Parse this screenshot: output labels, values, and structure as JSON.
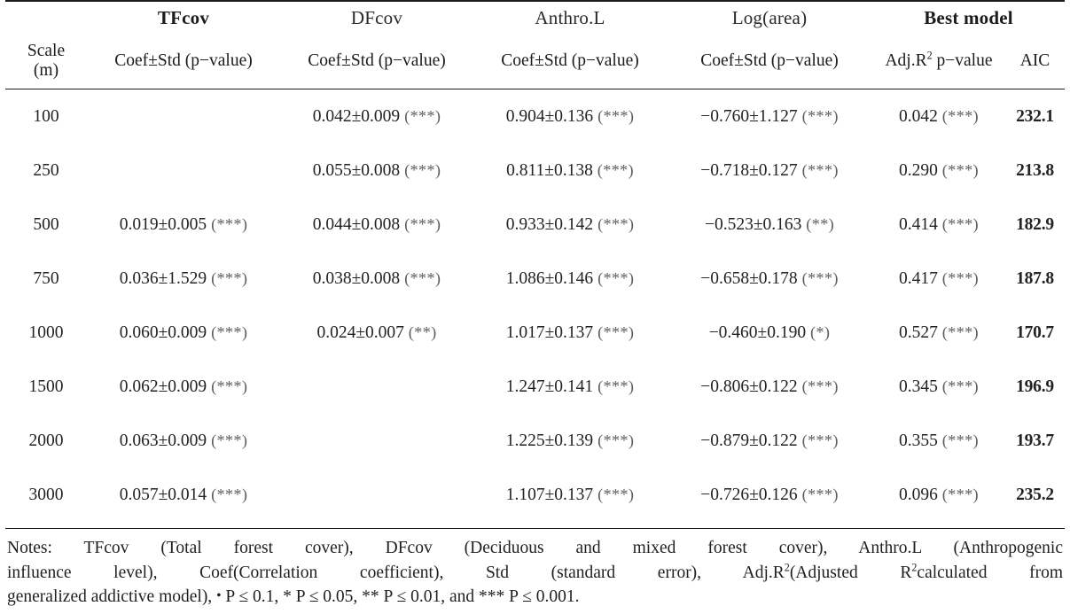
{
  "table": {
    "group_headers": [
      {
        "label": "",
        "style": "blank"
      },
      {
        "label": "TFcov",
        "style": "bold"
      },
      {
        "label": "DFcov",
        "style": "plain"
      },
      {
        "label": "Anthro.L",
        "style": "plain"
      },
      {
        "label": "Log(area)",
        "style": "plain"
      },
      {
        "label": "Best model",
        "style": "bold"
      }
    ],
    "sub_headers": {
      "scale_line1": "Scale",
      "scale_line2": "(m)",
      "tfcov": "Coef±Std (p−value)",
      "dfcov": "Coef±Std (p−value)",
      "anthro": "Coef±Std (p−value)",
      "logarea": "Coef±Std (p−value)",
      "adjr2_prefix": "Adj.R",
      "adjr2_sup": "2",
      "adjr2_suffix": " p−value",
      "aic": "AIC"
    },
    "rows": [
      {
        "scale": "100",
        "tfcov": "",
        "tfcov_sig": "",
        "dfcov": "0.042±0.009",
        "dfcov_sig": "(***)",
        "anthro": "0.904±0.136",
        "anthro_sig": "(***)",
        "logarea": "−0.760±1.127",
        "logarea_sig": "(***)",
        "adjr2": "0.042",
        "adjr2_sig": "(***)",
        "aic": "232.1"
      },
      {
        "scale": "250",
        "tfcov": "",
        "tfcov_sig": "",
        "dfcov": "0.055±0.008",
        "dfcov_sig": "(***)",
        "anthro": "0.811±0.138",
        "anthro_sig": "(***)",
        "logarea": "−0.718±0.127",
        "logarea_sig": "(***)",
        "adjr2": "0.290",
        "adjr2_sig": "(***)",
        "aic": "213.8"
      },
      {
        "scale": "500",
        "tfcov": "0.019±0.005",
        "tfcov_sig": "(***)",
        "dfcov": "0.044±0.008",
        "dfcov_sig": "(***)",
        "anthro": "0.933±0.142",
        "anthro_sig": "(***)",
        "logarea": "−0.523±0.163",
        "logarea_sig": "(**)",
        "adjr2": "0.414",
        "adjr2_sig": "(***)",
        "aic": "182.9"
      },
      {
        "scale": "750",
        "tfcov": "0.036±1.529",
        "tfcov_sig": "(***)",
        "dfcov": "0.038±0.008",
        "dfcov_sig": "(***)",
        "anthro": "1.086±0.146",
        "anthro_sig": "(***)",
        "logarea": "−0.658±0.178",
        "logarea_sig": "(***)",
        "adjr2": "0.417",
        "adjr2_sig": "(***)",
        "aic": "187.8"
      },
      {
        "scale": "1000",
        "tfcov": "0.060±0.009",
        "tfcov_sig": "(***)",
        "dfcov": "0.024±0.007",
        "dfcov_sig": "(**)",
        "anthro": "1.017±0.137",
        "anthro_sig": "(***)",
        "logarea": "−0.460±0.190",
        "logarea_sig": "(*)",
        "adjr2": "0.527",
        "adjr2_sig": "(***)",
        "aic": "170.7"
      },
      {
        "scale": "1500",
        "tfcov": "0.062±0.009",
        "tfcov_sig": "(***)",
        "dfcov": "",
        "dfcov_sig": "",
        "anthro": "1.247±0.141",
        "anthro_sig": "(***)",
        "logarea": "−0.806±0.122",
        "logarea_sig": "(***)",
        "adjr2": "0.345",
        "adjr2_sig": "(***)",
        "aic": "196.9"
      },
      {
        "scale": "2000",
        "tfcov": "0.063±0.009",
        "tfcov_sig": "(***)",
        "dfcov": "",
        "dfcov_sig": "",
        "anthro": "1.225±0.139",
        "anthro_sig": "(***)",
        "logarea": "−0.879±0.122",
        "logarea_sig": "(***)",
        "adjr2": "0.355",
        "adjr2_sig": "(***)",
        "aic": "193.7"
      },
      {
        "scale": "3000",
        "tfcov": "0.057±0.014",
        "tfcov_sig": "(***)",
        "dfcov": "",
        "dfcov_sig": "",
        "anthro": "1.107±0.137",
        "anthro_sig": "(***)",
        "logarea": "−0.726±0.126",
        "logarea_sig": "(***)",
        "adjr2": "0.096",
        "adjr2_sig": "(***)",
        "aic": "235.2"
      }
    ]
  },
  "notes": {
    "line1": "Notes: TFcov (Total forest cover), DFcov (Deciduous and mixed forest cover), Anthro.L (Anthropogenic",
    "line2_a": "influence level), Coef(Correlation coefficient), Std (standard error), Adj.R",
    "line2_sup": "2",
    "line2_b": "(Adjusted R",
    "line2_sup2": "2",
    "line2_c": "calculated from",
    "line3_a": "generalized addictive model), ",
    "line3_dot": "•",
    "line3_b": " P ≤ 0.1, * P ≤ 0.05, ** P ≤ 0.01, and *** P ≤ 0.001."
  }
}
